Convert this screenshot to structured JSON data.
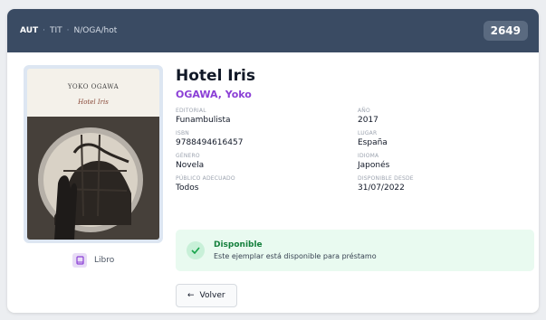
{
  "header": {
    "breadcrumb": [
      "AUT",
      "TIT",
      "N/OGA/hot"
    ],
    "separator": "·",
    "count": "2649"
  },
  "cover": {
    "author_text": "YOKO OGAWA",
    "title_text": "Hotel Iris"
  },
  "book": {
    "title": "Hotel Iris",
    "author": "OGAWA, Yoko",
    "type_label": "Libro",
    "fields": [
      {
        "label": "EDITORIAL",
        "value": "Funambulista"
      },
      {
        "label": "AÑO",
        "value": "2017"
      },
      {
        "label": "ISBN",
        "value": "9788494616457"
      },
      {
        "label": "LUGAR",
        "value": "España"
      },
      {
        "label": "GÉNERO",
        "value": "Novela"
      },
      {
        "label": "IDIOMA",
        "value": "Japonés"
      },
      {
        "label": "PÚBLICO ADECUADO",
        "value": "Todos"
      },
      {
        "label": "DISPONIBLE DESDE",
        "value": "31/07/2022"
      }
    ]
  },
  "availability": {
    "status": "Disponible",
    "message": "Este ejemplar está disponible para préstamo",
    "color": "#15803d"
  },
  "actions": {
    "back_label": "Volver"
  },
  "colors": {
    "header_bg": "#3a4b63",
    "accent": "#8b3fd6"
  }
}
